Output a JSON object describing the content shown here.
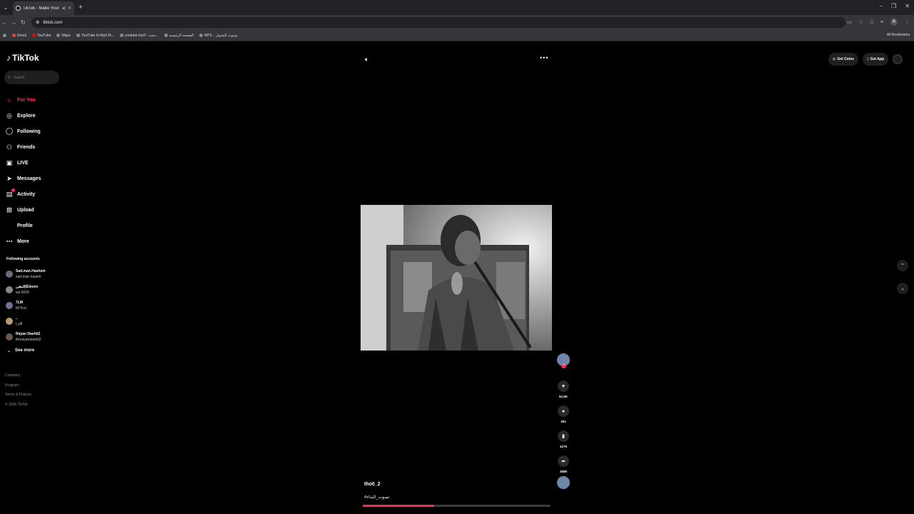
{
  "browser": {
    "tab_title": "TikTok - Make Your Day",
    "url": "tiktok.com",
    "profile_initial": "R",
    "bookmarks": [
      "Gmail",
      "YouTube",
      "Maps",
      "YouTube to Mp3 M...",
      "youtube mp3 - بحث...",
      "الصفحة الرئيسية",
      "MP3... يوتيوب التحويل"
    ],
    "all_bookmarks": "All Bookmarks"
  },
  "sidebar": {
    "logo": "TikTok",
    "search_placeholder": "Search",
    "nav": [
      {
        "label": "For You"
      },
      {
        "label": "Explore"
      },
      {
        "label": "Following"
      },
      {
        "label": "Friends"
      },
      {
        "label": "LIVE"
      },
      {
        "label": "Messages"
      },
      {
        "label": "Activity"
      },
      {
        "label": "Upload"
      },
      {
        "label": "Profile"
      },
      {
        "label": "More"
      }
    ],
    "following_header": "Following accounts",
    "accounts": [
      {
        "name": "Sad.man.Hashem",
        "handle": "sad.man.hasem"
      },
      {
        "name": "إليفن/Eleven",
        "handle": "sul.5020"
      },
      {
        "name": "7LM",
        "handle": "fd74.tz"
      },
      {
        "name": "..",
        "handle": "i_p8"
      },
      {
        "name": "Rayan Dashti2",
        "handle": "therayandashti2"
      }
    ],
    "see_more": "See more",
    "footer": [
      "Company",
      "Program",
      "Terms & Policies",
      "© 2026 TikTok"
    ]
  },
  "topbar": {
    "get_coins": "Get Coins",
    "get_app": "Get App"
  },
  "video": {
    "creator": "tho0_2",
    "caption": "#تصوت_البداء",
    "likes": "52.8K",
    "comments": "351",
    "saves": "4275",
    "shares": "3589",
    "progress_percent": 38
  }
}
